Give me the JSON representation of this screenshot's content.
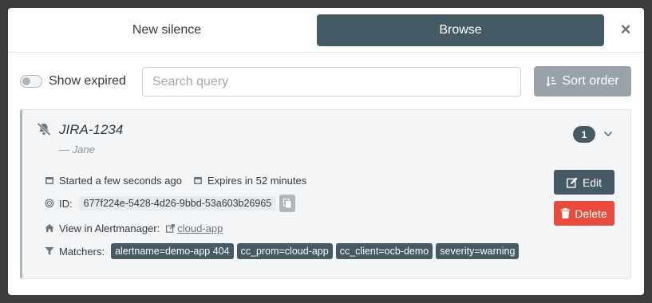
{
  "tabs": {
    "new_silence": "New silence",
    "browse": "Browse"
  },
  "close_icon": "×",
  "filters": {
    "show_expired_label": "Show expired",
    "show_expired_checked": false,
    "search_placeholder": "Search query",
    "search_value": "",
    "sort_label": "Sort order"
  },
  "silence": {
    "title": "JIRA-1234",
    "author": "— Jane",
    "alert_count": "1",
    "started": "Started a few seconds ago",
    "expires": "Expires in 52 minutes",
    "id_label": "ID:",
    "id": "677f224e-5428-4d26-9bbd-53a603b26965",
    "view_label": "View in Alertmanager:",
    "view_link": "cloud-app",
    "matchers_label": "Matchers:",
    "matchers": [
      "alertname=demo-app 404",
      "cc_prom=cloud-app",
      "cc_client=ocb-demo",
      "severity=warning"
    ],
    "edit_label": "Edit",
    "delete_label": "Delete"
  },
  "colors": {
    "primary": "#455a64",
    "danger": "#e74c3c",
    "muted": "#97a3a8"
  }
}
